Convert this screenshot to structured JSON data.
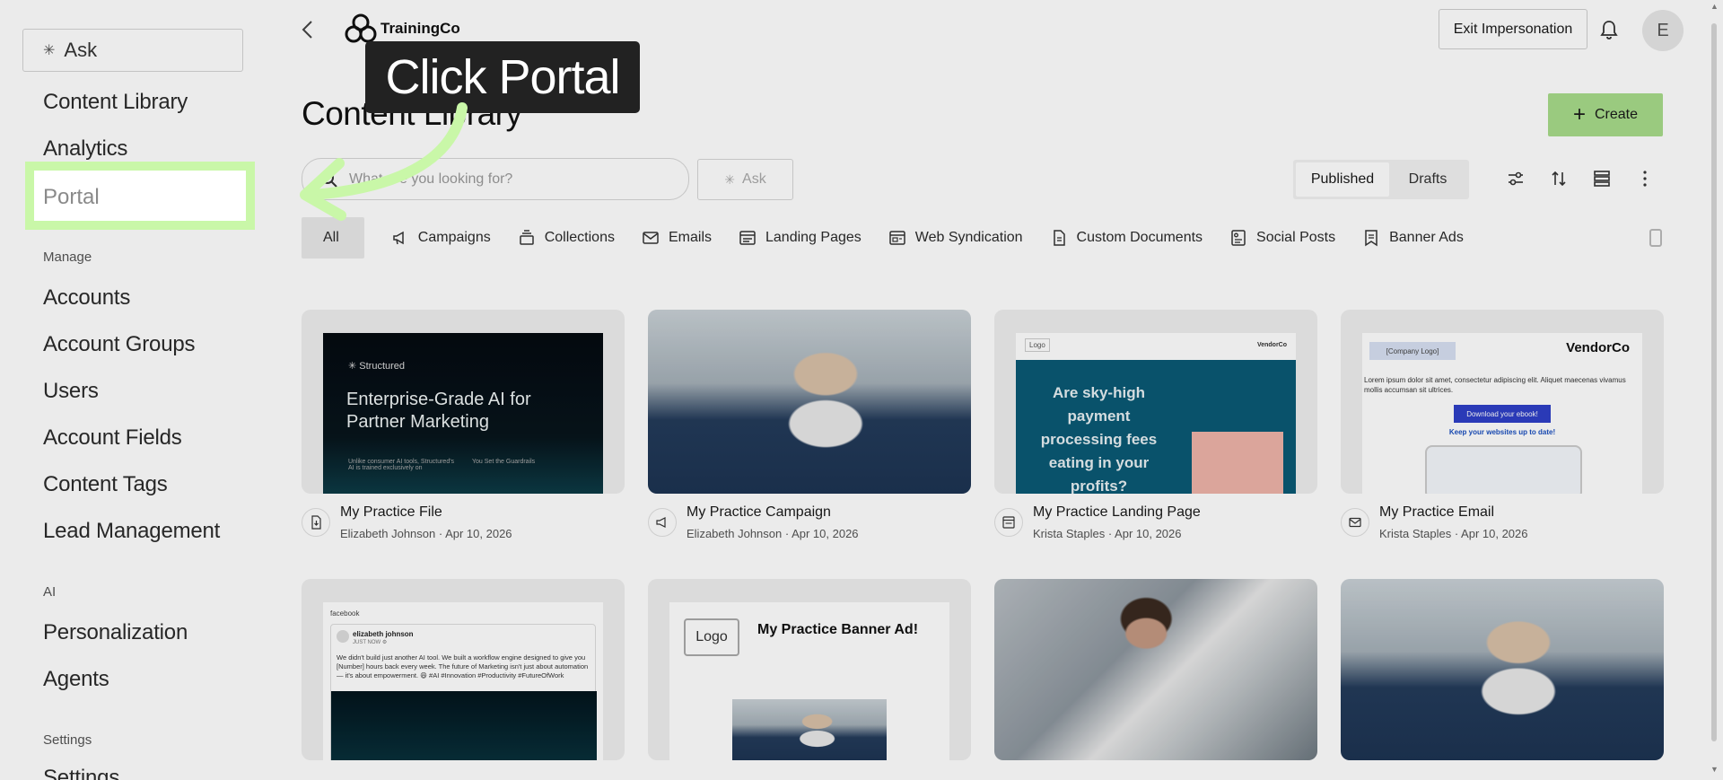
{
  "sidebar": {
    "ask_label": "Ask",
    "items": [
      {
        "label": "Content Library"
      },
      {
        "label": "Analytics"
      },
      {
        "label": "Portal"
      }
    ],
    "sections": [
      {
        "label": "Manage",
        "items": [
          "Accounts",
          "Account Groups",
          "Users",
          "Account Fields",
          "Content Tags",
          "Lead Management"
        ]
      },
      {
        "label": "AI",
        "items": [
          "Personalization",
          "Agents"
        ]
      },
      {
        "label": "Settings",
        "items": [
          "Settings"
        ]
      }
    ]
  },
  "header": {
    "brand": "TrainingCo",
    "exit_label": "Exit Impersonation",
    "avatar_initial": "E"
  },
  "main": {
    "title": "Content Library",
    "create_label": "Create",
    "search_placeholder": "What are you looking for?",
    "ask_label": "Ask",
    "toggle": {
      "published": "Published",
      "drafts": "Drafts"
    },
    "filters": [
      "All",
      "Campaigns",
      "Collections",
      "Emails",
      "Landing Pages",
      "Web Syndication",
      "Custom Documents",
      "Social Posts",
      "Banner Ads"
    ],
    "cards": [
      {
        "title": "My Practice File",
        "author": "Elizabeth Johnson",
        "date": "Apr 10, 2026",
        "icon": "file-download-icon"
      },
      {
        "title": "My Practice Campaign",
        "author": "Elizabeth Johnson",
        "date": "Apr 10, 2026",
        "icon": "megaphone-icon"
      },
      {
        "title": "My Practice Landing Page",
        "author": "Krista Staples",
        "date": "Apr 10, 2026",
        "icon": "landing-page-icon"
      },
      {
        "title": "My Practice Email",
        "author": "Krista Staples",
        "date": "Apr 10, 2026",
        "icon": "email-icon"
      }
    ],
    "thumbs": {
      "file": {
        "brand": "✳ Structured",
        "headline": "Enterprise-Grade AI for Partner Marketing",
        "foot1": "Unlike consumer AI tools, Structured's AI is trained exclusively on",
        "foot2": "You Set the Guardrails"
      },
      "landing": {
        "logo": "Logo",
        "vendor": "VendorCo",
        "headline": "Are sky-high payment processing fees eating in your profits?"
      },
      "email": {
        "company_logo": "[Company Logo]",
        "vendor": "VendorCo",
        "lorem": "Lorem ipsum dolor sit amet, consectetur adipiscing elit. Aliquet maecenas vivamus mollis accumsan sit ultrices.",
        "download": "Download your ebook!",
        "keep": "Keep your websites up to date!"
      },
      "social": {
        "network": "facebook",
        "name": "elizabeth johnson",
        "time": "JUST NOW ⚙",
        "body": "We didn't build just another AI tool. We built a workflow engine designed to give you [Number] hours back every week. The future of Marketing isn't just about automation — it's about empowerment. 😄 #AI #Innovation #Productivity #FutureOfWork"
      },
      "banner": {
        "logo": "Logo",
        "headline": "My Practice Banner Ad!"
      }
    }
  },
  "tooltip": {
    "text": "Click Portal"
  },
  "colors": {
    "highlight": "#c9f7a8",
    "create": "#a8dc8a",
    "tooltip_bg": "#222222"
  }
}
